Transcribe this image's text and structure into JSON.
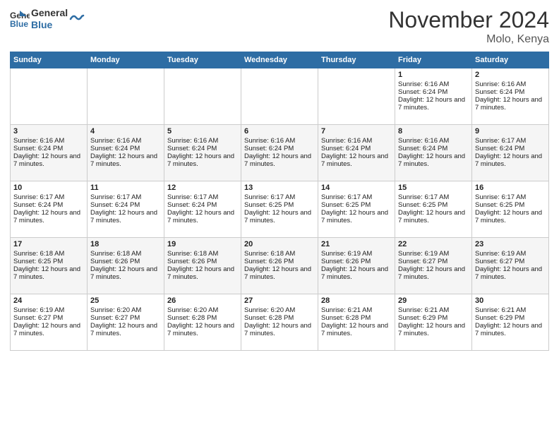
{
  "logo": {
    "line1": "General",
    "line2": "Blue"
  },
  "title": "November 2024",
  "location": "Molo, Kenya",
  "days_of_week": [
    "Sunday",
    "Monday",
    "Tuesday",
    "Wednesday",
    "Thursday",
    "Friday",
    "Saturday"
  ],
  "weeks": [
    [
      {
        "day": "",
        "info": ""
      },
      {
        "day": "",
        "info": ""
      },
      {
        "day": "",
        "info": ""
      },
      {
        "day": "",
        "info": ""
      },
      {
        "day": "",
        "info": ""
      },
      {
        "day": "1",
        "sunrise": "6:16 AM",
        "sunset": "6:24 PM",
        "daylight": "12 hours and 7 minutes."
      },
      {
        "day": "2",
        "sunrise": "6:16 AM",
        "sunset": "6:24 PM",
        "daylight": "12 hours and 7 minutes."
      }
    ],
    [
      {
        "day": "3",
        "sunrise": "6:16 AM",
        "sunset": "6:24 PM",
        "daylight": "12 hours and 7 minutes."
      },
      {
        "day": "4",
        "sunrise": "6:16 AM",
        "sunset": "6:24 PM",
        "daylight": "12 hours and 7 minutes."
      },
      {
        "day": "5",
        "sunrise": "6:16 AM",
        "sunset": "6:24 PM",
        "daylight": "12 hours and 7 minutes."
      },
      {
        "day": "6",
        "sunrise": "6:16 AM",
        "sunset": "6:24 PM",
        "daylight": "12 hours and 7 minutes."
      },
      {
        "day": "7",
        "sunrise": "6:16 AM",
        "sunset": "6:24 PM",
        "daylight": "12 hours and 7 minutes."
      },
      {
        "day": "8",
        "sunrise": "6:16 AM",
        "sunset": "6:24 PM",
        "daylight": "12 hours and 7 minutes."
      },
      {
        "day": "9",
        "sunrise": "6:17 AM",
        "sunset": "6:24 PM",
        "daylight": "12 hours and 7 minutes."
      }
    ],
    [
      {
        "day": "10",
        "sunrise": "6:17 AM",
        "sunset": "6:24 PM",
        "daylight": "12 hours and 7 minutes."
      },
      {
        "day": "11",
        "sunrise": "6:17 AM",
        "sunset": "6:24 PM",
        "daylight": "12 hours and 7 minutes."
      },
      {
        "day": "12",
        "sunrise": "6:17 AM",
        "sunset": "6:24 PM",
        "daylight": "12 hours and 7 minutes."
      },
      {
        "day": "13",
        "sunrise": "6:17 AM",
        "sunset": "6:25 PM",
        "daylight": "12 hours and 7 minutes."
      },
      {
        "day": "14",
        "sunrise": "6:17 AM",
        "sunset": "6:25 PM",
        "daylight": "12 hours and 7 minutes."
      },
      {
        "day": "15",
        "sunrise": "6:17 AM",
        "sunset": "6:25 PM",
        "daylight": "12 hours and 7 minutes."
      },
      {
        "day": "16",
        "sunrise": "6:17 AM",
        "sunset": "6:25 PM",
        "daylight": "12 hours and 7 minutes."
      }
    ],
    [
      {
        "day": "17",
        "sunrise": "6:18 AM",
        "sunset": "6:25 PM",
        "daylight": "12 hours and 7 minutes."
      },
      {
        "day": "18",
        "sunrise": "6:18 AM",
        "sunset": "6:26 PM",
        "daylight": "12 hours and 7 minutes."
      },
      {
        "day": "19",
        "sunrise": "6:18 AM",
        "sunset": "6:26 PM",
        "daylight": "12 hours and 7 minutes."
      },
      {
        "day": "20",
        "sunrise": "6:18 AM",
        "sunset": "6:26 PM",
        "daylight": "12 hours and 7 minutes."
      },
      {
        "day": "21",
        "sunrise": "6:19 AM",
        "sunset": "6:26 PM",
        "daylight": "12 hours and 7 minutes."
      },
      {
        "day": "22",
        "sunrise": "6:19 AM",
        "sunset": "6:27 PM",
        "daylight": "12 hours and 7 minutes."
      },
      {
        "day": "23",
        "sunrise": "6:19 AM",
        "sunset": "6:27 PM",
        "daylight": "12 hours and 7 minutes."
      }
    ],
    [
      {
        "day": "24",
        "sunrise": "6:19 AM",
        "sunset": "6:27 PM",
        "daylight": "12 hours and 7 minutes."
      },
      {
        "day": "25",
        "sunrise": "6:20 AM",
        "sunset": "6:27 PM",
        "daylight": "12 hours and 7 minutes."
      },
      {
        "day": "26",
        "sunrise": "6:20 AM",
        "sunset": "6:28 PM",
        "daylight": "12 hours and 7 minutes."
      },
      {
        "day": "27",
        "sunrise": "6:20 AM",
        "sunset": "6:28 PM",
        "daylight": "12 hours and 7 minutes."
      },
      {
        "day": "28",
        "sunrise": "6:21 AM",
        "sunset": "6:28 PM",
        "daylight": "12 hours and 7 minutes."
      },
      {
        "day": "29",
        "sunrise": "6:21 AM",
        "sunset": "6:29 PM",
        "daylight": "12 hours and 7 minutes."
      },
      {
        "day": "30",
        "sunrise": "6:21 AM",
        "sunset": "6:29 PM",
        "daylight": "12 hours and 7 minutes."
      }
    ]
  ]
}
